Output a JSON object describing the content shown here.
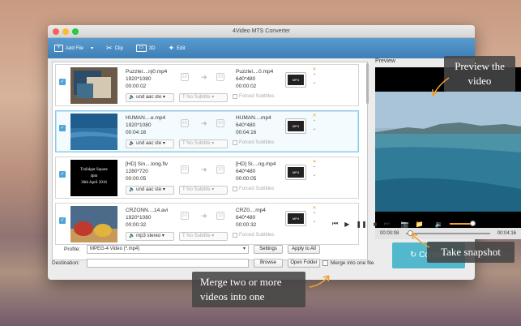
{
  "window": {
    "title": "4Video MTS Converter"
  },
  "toolbar": {
    "add_file": "Add File",
    "add_file_arrow": "▾",
    "clip": "Clip",
    "threed": "3D",
    "edit": "Edit"
  },
  "files": [
    {
      "src_name": "Puzzlel....nj0.mp4",
      "src_res": "1920*1080",
      "src_dur": "00:00:02",
      "dst_name": "Puzzlel....0.mp4",
      "dst_res": "640*480",
      "dst_dur": "00:00:02",
      "audio": "und aac ste",
      "subtitle": "No Subtitle",
      "forced": "Forced Subtitles",
      "checked": true
    },
    {
      "src_name": "HUMAN....e.mp4",
      "src_res": "1920*1080",
      "src_dur": "00:04:16",
      "dst_name": "HUMAN....mp4",
      "dst_res": "640*480",
      "dst_dur": "00:04:16",
      "audio": "und aac ste",
      "subtitle": "No Subtitle",
      "forced": "Forced Subtitles",
      "checked": true
    },
    {
      "src_name": "[HD] Sin....long.flv",
      "src_res": "1280*720",
      "src_dur": "00:00:05",
      "dst_name": "[HD] Si....ng.mp4",
      "dst_res": "640*480",
      "dst_dur": "00:00:05",
      "audio": "und aac ste",
      "subtitle": "No Subtitle",
      "forced": "Forced Subtitles",
      "checked": true
    },
    {
      "src_name": "CRZONN....14.avi",
      "src_res": "1920*1080",
      "src_dur": "00:00:32",
      "dst_name": "CRZ0....mp4",
      "dst_res": "640*480",
      "dst_dur": "00:00:32",
      "audio": "mp3 stereo",
      "subtitle": "No Subtitle",
      "forced": "Forced Subtitles",
      "checked": true
    }
  ],
  "thumb3_text": [
    "Trafalgar Square",
    "4pm",
    "30th April 2016"
  ],
  "format_box": "3D",
  "format_icon": "MP4",
  "preview": {
    "label": "Preview",
    "time_current": "00:00:08",
    "time_total": "00:04:16",
    "progress": 0.03,
    "volume": 0.8
  },
  "bottom": {
    "profile_label": "Profile:",
    "profile_value": "MPEG-4 Video (*.mp4)",
    "settings": "Settings",
    "apply_all": "Apply to All",
    "destination_label": "Destination:",
    "browse": "Browse",
    "open_folder": "Open Folder",
    "merge": "Merge into one file",
    "convert": "Convert"
  },
  "callouts": {
    "preview": "Preview the\nvideo",
    "snapshot": "Take snapshot",
    "merge": "Merge two or more\nvideos into one"
  },
  "colors": {
    "accent": "#52b9cc",
    "toolbar": "#4a8ec4",
    "check": "#4ea4d8",
    "orange": "#f0a030"
  }
}
